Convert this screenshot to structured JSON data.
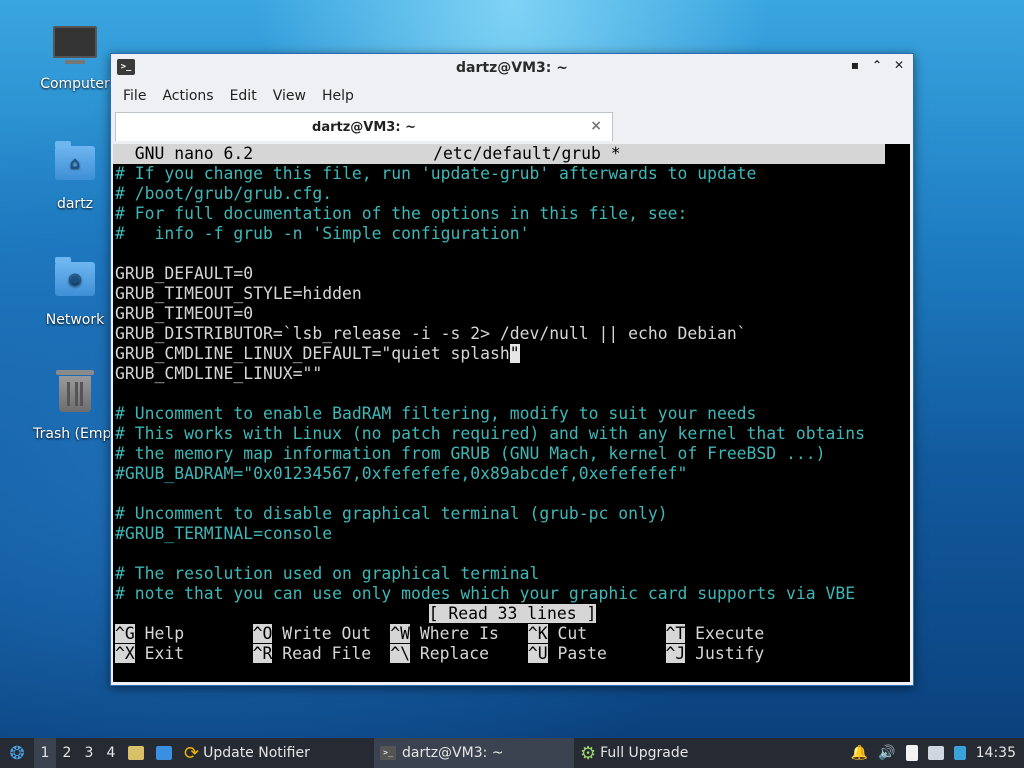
{
  "desktop": {
    "icons": [
      {
        "label": "Computer",
        "icon": "computer-icon"
      },
      {
        "label": "dartz",
        "icon": "home-folder-icon"
      },
      {
        "label": "Network",
        "icon": "network-folder-icon"
      },
      {
        "label": "Trash (Empt",
        "icon": "trash-icon"
      }
    ]
  },
  "window": {
    "title": "dartz@VM3: ~",
    "controls": {
      "minimize": "▪",
      "maximize": "⌃",
      "close": "✕"
    },
    "menu": [
      "File",
      "Actions",
      "Edit",
      "View",
      "Help"
    ],
    "tab_label": "dartz@VM3: ~",
    "tab_close": "×"
  },
  "nano": {
    "header_left": "  GNU nano 6.2",
    "header_file": "/etc/default/grub *",
    "lines": [
      "# If you change this file, run 'update-grub' afterwards to update",
      "# /boot/grub/grub.cfg.",
      "# For full documentation of the options in this file, see:",
      "#   info -f grub -n 'Simple configuration'",
      "",
      "GRUB_DEFAULT=0",
      "GRUB_TIMEOUT_STYLE=hidden",
      "GRUB_TIMEOUT=0",
      "GRUB_DISTRIBUTOR=`lsb_release -i -s 2> /dev/null || echo Debian`",
      "GRUB_CMDLINE_LINUX_DEFAULT=\"quiet splash",
      "GRUB_CMDLINE_LINUX=\"\"",
      "",
      "# Uncomment to enable BadRAM filtering, modify to suit your needs",
      "# This works with Linux (no patch required) and with any kernel that obtains",
      "# the memory map information from GRUB (GNU Mach, kernel of FreeBSD ...)",
      "#GRUB_BADRAM=\"0x01234567,0xfefefefe,0x89abcdef,0xefefefef\"",
      "",
      "# Uncomment to disable graphical terminal (grub-pc only)",
      "#GRUB_TERMINAL=console",
      "",
      "# The resolution used on graphical terminal",
      "# note that you can use only modes which your graphic card supports via VBE"
    ],
    "cursor_char": "\"",
    "status": "[ Read 33 lines ]",
    "shortcuts_row1": [
      {
        "key": "^G",
        "label": "Help"
      },
      {
        "key": "^O",
        "label": "Write Out"
      },
      {
        "key": "^W",
        "label": "Where Is"
      },
      {
        "key": "^K",
        "label": "Cut"
      },
      {
        "key": "^T",
        "label": "Execute"
      }
    ],
    "shortcuts_row2": [
      {
        "key": "^X",
        "label": "Exit"
      },
      {
        "key": "^R",
        "label": "Read File"
      },
      {
        "key": "^\\",
        "label": "Replace"
      },
      {
        "key": "^U",
        "label": "Paste"
      },
      {
        "key": "^J",
        "label": "Justify"
      }
    ]
  },
  "taskbar": {
    "workspaces": [
      "1",
      "2",
      "3",
      "4"
    ],
    "active_workspace": "1",
    "items": [
      {
        "label": "Update Notifier",
        "icon": "update-notifier-icon"
      },
      {
        "label": "dartz@VM3: ~",
        "icon": "terminal-icon"
      },
      {
        "label": "Full Upgrade",
        "icon": "gear-icon"
      }
    ],
    "clock": "14:35"
  },
  "colors": {
    "comment": "#3fb6b6",
    "window_border": "#2b6cb8",
    "taskbar_bg": "#252a33"
  }
}
